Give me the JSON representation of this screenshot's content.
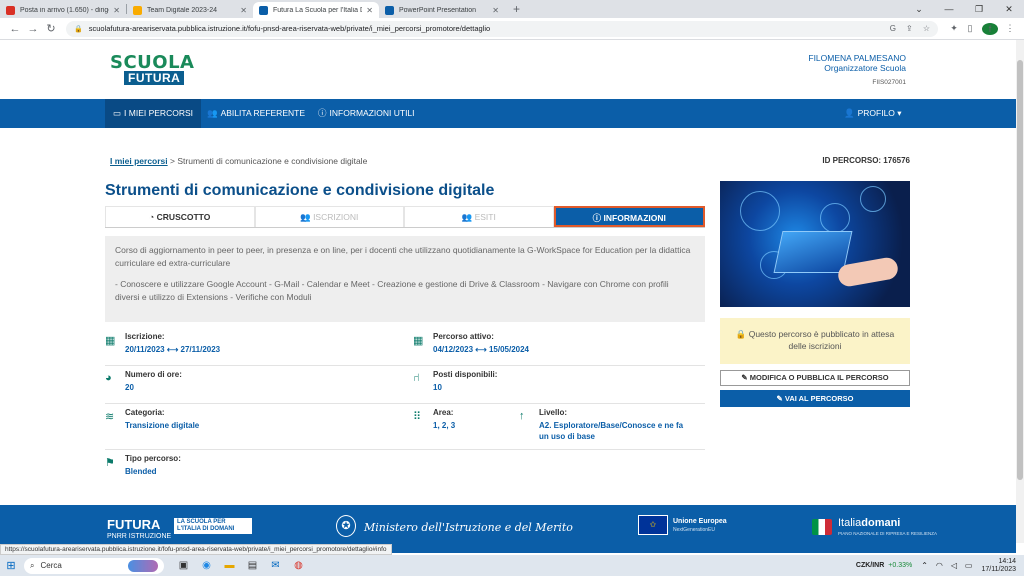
{
  "browser": {
    "tabs": [
      {
        "title": "Posta in arrivo (1.650) - dirigente",
        "color": "#d93025"
      },
      {
        "title": "Team Digitale 2023-24",
        "color": "#f9ab00"
      },
      {
        "title": "Futura La Scuola per l'Italia Dom",
        "color": "#0b5ea8"
      },
      {
        "title": "PowerPoint Presentation",
        "color": "#0b5ea8"
      }
    ],
    "new_tab": "+",
    "url": "scuolafutura-areariservata.pubblica.istruzione.it/fofu-pnsd-area-riservata-web/private/i_miei_percorsi_promotore/dettaglio",
    "profile_initial": "f"
  },
  "header": {
    "logo_line1": "SCUOLA",
    "logo_line2": "FUTURA",
    "user_name": "FILOMENA PALMESANO",
    "user_role": "Organizzatore Scuola",
    "user_code": "FIIS027001"
  },
  "nav": {
    "items": [
      "I MIEI PERCORSI",
      "ABILITA REFERENTE",
      "INFORMAZIONI UTILI"
    ],
    "profile": "PROFILO"
  },
  "breadcrumb": {
    "link": "I miei percorsi",
    "separator": ">",
    "current": "Strumenti di comunicazione e condivisione digitale"
  },
  "percorso_id": "ID PERCORSO: 176576",
  "title": "Strumenti di comunicazione e condivisione digitale",
  "tabs": [
    "CRUSCOTTO",
    "ISCRIZIONI",
    "ESITI",
    "INFORMAZIONI"
  ],
  "description": {
    "p1": "Corso di aggiornamento in peer to peer, in presenza e on line, per i docenti che utilizzano quotidianamente la G-WorkSpace for Education per la didattica curriculare ed extra-curriculare",
    "p2": "- Conoscere e utilizzare Google Account - G-Mail - Calendar e Meet - Creazione e gestione di Drive & Classroom - Navigare con Chrome con profili diversi e utilizzo di Extensions - Verifiche con Moduli"
  },
  "info": {
    "iscrizione_label": "Iscrizione:",
    "iscrizione_value": "20/11/2023 ⟷ 27/11/2023",
    "attivo_label": "Percorso attivo:",
    "attivo_value": "04/12/2023 ⟷ 15/05/2024",
    "ore_label": "Numero di ore:",
    "ore_value": "20",
    "posti_label": "Posti disponibili:",
    "posti_value": "10",
    "categoria_label": "Categoria:",
    "categoria_value": "Transizione digitale",
    "area_label": "Area:",
    "area_value": "1, 2, 3",
    "livello_label": "Livello:",
    "livello_value": "A2. Esploratore/Base/Conosce e ne fa un uso di base",
    "tipo_label": "Tipo percorso:",
    "tipo_value": "Blended"
  },
  "sidebar": {
    "notice": "Questo percorso è pubblicato in attesa delle iscrizioni",
    "modify_button": "MODIFICA O PUBBLICA IL PERCORSO",
    "go_button": "VAI AL PERCORSO"
  },
  "footer": {
    "futura": "FUTURA",
    "futura_sub": "PNRR ISTRUZIONE",
    "scuola_tag": "LA SCUOLA PER L'ITALIA DI DOMANI",
    "ministero": "Ministero dell'Istruzione e del Merito",
    "eu": "Unione Europea",
    "eu_sub": "NextGenerationEU",
    "italia_light": "Italia",
    "italia_bold": "domani",
    "italia_sub": "PIANO NAZIONALE DI RIPRESA E RESILIENZA"
  },
  "status_url": "https://scuolafutura-areariservata.pubblica.istruzione.it/fofu-pnsd-area-riservata-web/private/i_miei_percorsi_promotore/dettaglio#info",
  "taskbar": {
    "search": "Cerca",
    "ticker_name": "CZK/INR",
    "ticker_change": "+0.33%",
    "time": "14:14",
    "date": "17/11/2023"
  }
}
